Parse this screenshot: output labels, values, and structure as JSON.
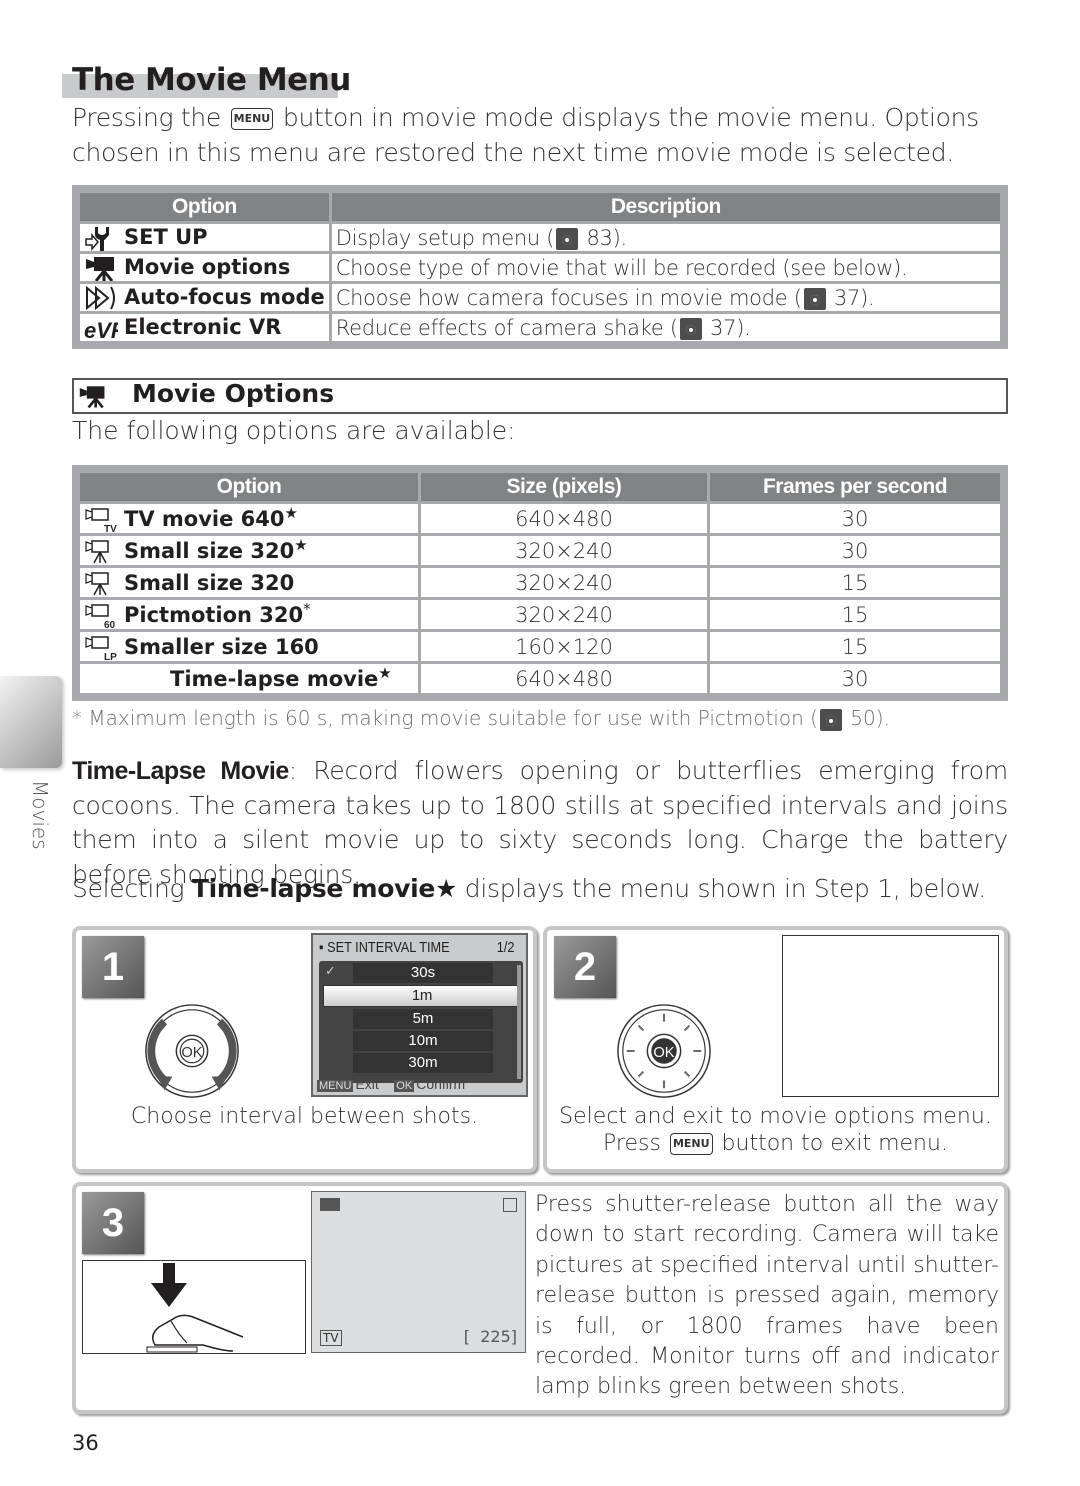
{
  "page": {
    "title": "The Movie Menu",
    "intro_before_button": "Pressing the ",
    "menu_button_label": "MENU",
    "intro_after_button": " button in movie mode displays the movie menu.  Options chosen in this menu are restored the next time movie mode is selected.",
    "page_number": "36",
    "side_tab_label": "Movies"
  },
  "menu_table": {
    "headers": [
      "Option",
      "Description"
    ],
    "rows": [
      {
        "icon": "setup-wrench-icon",
        "option": "SET UP",
        "desc_before": "Display setup menu (",
        "ref_icon": "page-reference-icon",
        "desc_after": " 83)."
      },
      {
        "icon": "movie-camera-icon",
        "option": "Movie options",
        "desc_before": "Choose type of movie that will be recorded (see below).",
        "ref_icon": "",
        "desc_after": ""
      },
      {
        "icon": "autofocus-icon",
        "option": "Auto-focus mode",
        "desc_before": "Choose how camera focuses in movie mode (",
        "ref_icon": "page-reference-icon",
        "desc_after": " 37)."
      },
      {
        "icon": "electronic-vr-icon",
        "option": "Electronic VR",
        "desc_before": "Reduce effects of camera shake (",
        "ref_icon": "page-reference-icon",
        "desc_after": " 37)."
      }
    ]
  },
  "movie_options": {
    "heading": "Movie Options",
    "intro": "The following options are available:",
    "headers": [
      "Option",
      "Size (pixels)",
      "Frames per second"
    ],
    "rows": [
      {
        "icon": "tv-movie-icon",
        "option": "TV movie 640",
        "mark": "★",
        "size": "640×480",
        "fps": "30"
      },
      {
        "icon": "small-size-star-icon",
        "option": "Small size 320",
        "mark": "★",
        "size": "320×240",
        "fps": "30"
      },
      {
        "icon": "small-size-icon",
        "option": "Small size 320",
        "mark": "",
        "size": "320×240",
        "fps": "15"
      },
      {
        "icon": "pictmotion-icon",
        "option": "Pictmotion 320",
        "mark": "*",
        "size": "320×240",
        "fps": "15"
      },
      {
        "icon": "smaller-size-icon",
        "option": "Smaller size 160",
        "mark": "",
        "size": "160×120",
        "fps": "15"
      },
      {
        "icon": "",
        "option": "Time-lapse movie",
        "mark": "★",
        "size": "640×480",
        "fps": "30"
      }
    ],
    "footnote_before": "*  Maximum length is 60 s, making movie suitable for use with Pictmotion (",
    "footnote_after": " 50)."
  },
  "time_lapse": {
    "term": "Time-Lapse Movie",
    "body": ": Record flowers opening or butterflies emerging from cocoons. The camera takes up to 1800 stills at specified intervals and joins them into a silent movie up to sixty seconds long.  Charge the battery before shooting begins.",
    "select_before": "Selecting ",
    "select_bold": "Time-lapse movie★",
    "select_after": " displays the menu shown in Step 1, below."
  },
  "steps": [
    {
      "number": "1",
      "caption": "Choose interval between shots.",
      "lcd": {
        "title": "SET INTERVAL TIME",
        "page": "1/2",
        "items": [
          "30s",
          "1m",
          "5m",
          "10m",
          "30m"
        ],
        "checked_index": 0,
        "selected_index": 1,
        "exit_tag": "MENU",
        "exit_label": "Exit",
        "confirm_tag": "OK",
        "confirm_label": "Confirm"
      },
      "dial_label": "OK"
    },
    {
      "number": "2",
      "caption_line1": "Select and exit to movie options menu.",
      "caption_line2_before": "Press ",
      "menu_button_label": "MENU",
      "caption_line2_after": " button to exit menu.",
      "dial_label": "OK"
    },
    {
      "number": "3",
      "text": "Press shutter-release button all the way down to start recording.  Camera will take pictures at specified interval until shutter-release button is pressed again, memory is full, or 1800 frames have been recorded. Monitor turns off and indicator lamp blinks green between shots.",
      "monitor": {
        "mode_label": "TV",
        "frames_remaining": "225"
      }
    }
  ]
}
